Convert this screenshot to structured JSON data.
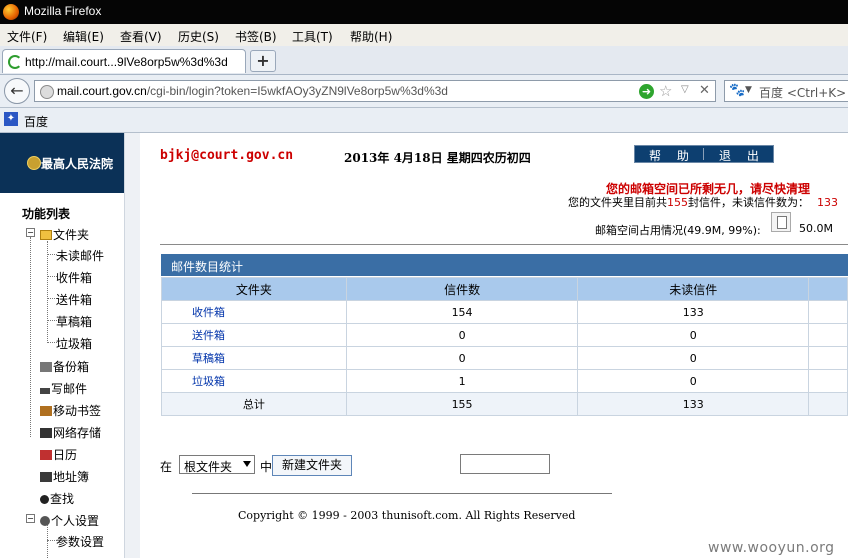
{
  "window": {
    "title": "Mozilla Firefox"
  },
  "menubar": {
    "items": [
      "文件(F)",
      "编辑(E)",
      "查看(V)",
      "历史(S)",
      "书签(B)",
      "工具(T)",
      "帮助(H)"
    ]
  },
  "tabs": {
    "active_label": "http://mail.court...9lVe8orp5w%3d%3d",
    "new_tab_label": "+"
  },
  "navbar": {
    "back_label": "←",
    "url_host": "mail.court.gov.cn",
    "url_rest": "/cgi-bin/login?token=I5wkfAOy3yZN9lVe8orp5w%3d%3d",
    "go_label": "➜",
    "star_label": "☆",
    "drop_label": "▽",
    "stop_label": "✕",
    "search_engine_label": "🐾",
    "search_caret": "▼",
    "search_placeholder": "百度 <Ctrl+K>"
  },
  "bookmarks": {
    "items": [
      {
        "label": "百度"
      }
    ]
  },
  "sidebar": {
    "logo_text": "最高人民法院",
    "title": "功能列表",
    "folder_root": "文件夹",
    "folders": [
      "未读邮件",
      "收件箱",
      "送件箱",
      "草稿箱",
      "垃圾箱"
    ],
    "items": [
      "备份箱",
      "写邮件",
      "移动书签",
      "网络存储",
      "日历",
      "地址簿",
      "查找"
    ],
    "settings_root": "个人设置",
    "settings_items": [
      "参数设置"
    ]
  },
  "header": {
    "email": "bjkj@court.gov.cn",
    "date": "2013年  4月18日  星期四农历初四",
    "help_label": "帮 助",
    "logout_label": "退 出",
    "warning": "您的邮箱空间已所剩无几，请尽快清理",
    "counts_prefix": "您的文件夹里目前共",
    "counts_total": "155",
    "counts_mid": "封信件，未读信件数为：",
    "counts_unread": "133",
    "usage_label": "邮箱空间占用情况(49.9M, 99%):",
    "usage_value": "50.0M"
  },
  "stats": {
    "title": "邮件数目统计",
    "columns": [
      "文件夹",
      "信件数",
      "未读信件"
    ],
    "rows": [
      {
        "folder": "收件箱",
        "count": "154",
        "unread": "133"
      },
      {
        "folder": "送件箱",
        "count": "0",
        "unread": "0"
      },
      {
        "folder": "草稿箱",
        "count": "0",
        "unread": "0"
      },
      {
        "folder": "垃圾箱",
        "count": "1",
        "unread": "0"
      }
    ],
    "total_label": "总计",
    "total_count": "155",
    "total_unread": "133"
  },
  "form": {
    "in_label": "在",
    "folder_select_value": "根文件夹",
    "zhong_label": "中",
    "create_button": "新建文件夹"
  },
  "footer": {
    "copyright": "Copyright © 1999 - 2003 thunisoft.com. All Rights Reserved"
  },
  "watermark": "www.wooyun.org"
}
